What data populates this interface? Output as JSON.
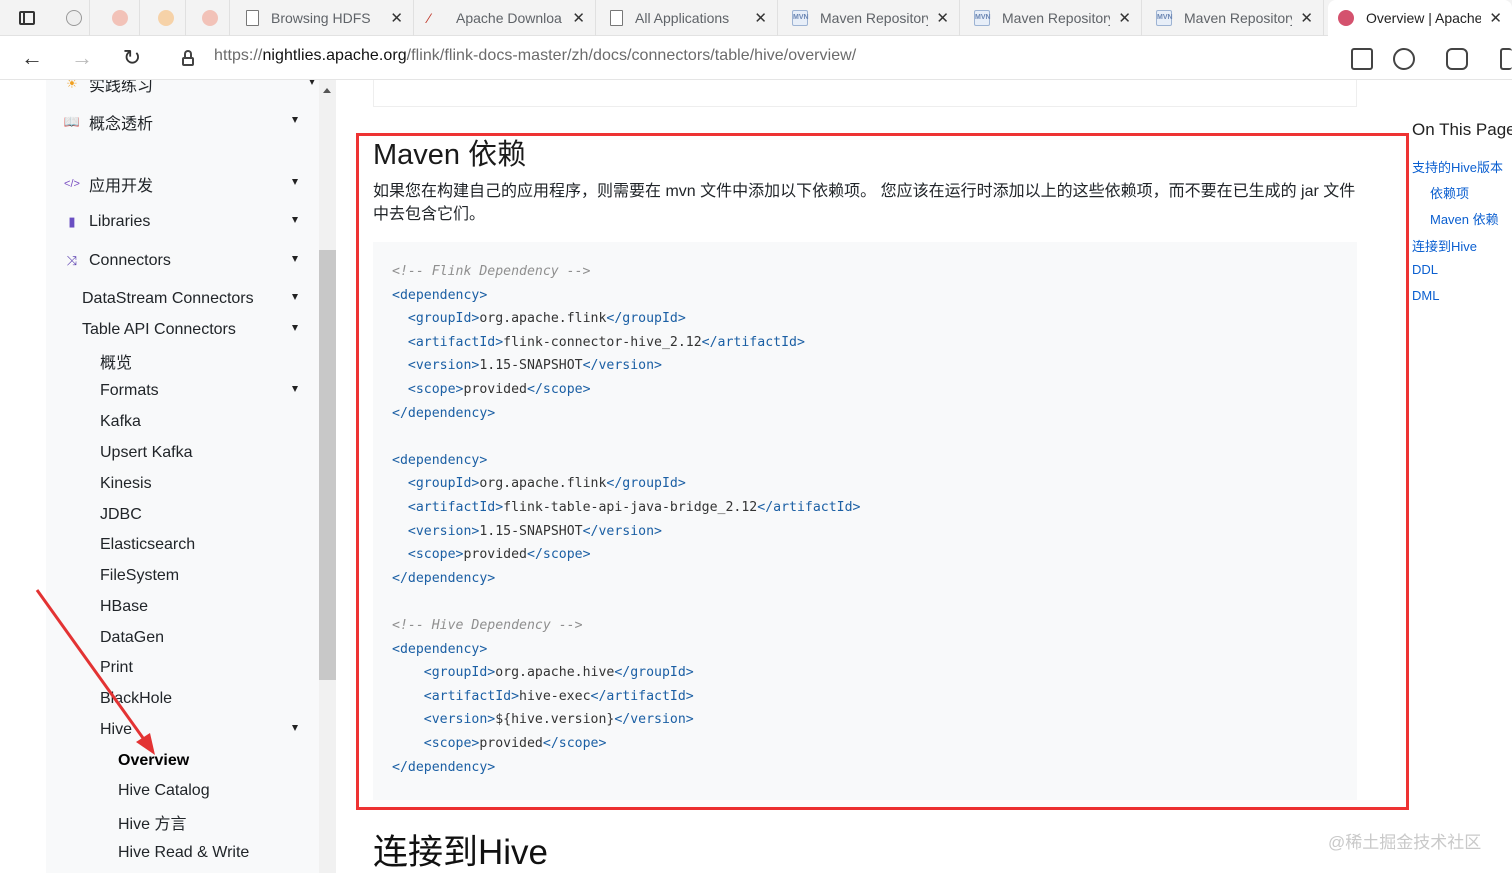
{
  "tabs": [
    {
      "label": "Browsing HDFS",
      "icon": "page-icon"
    },
    {
      "label": "Apache Downloa",
      "icon": "feather-icon"
    },
    {
      "label": "All Applications",
      "icon": "page-icon"
    },
    {
      "label": "Maven Repository",
      "icon": "mvn-icon"
    },
    {
      "label": "Maven Repository",
      "icon": "mvn-icon"
    },
    {
      "label": "Maven Repository",
      "icon": "mvn-icon"
    },
    {
      "label": "Overview | Apache",
      "icon": "flink-icon",
      "active": true
    }
  ],
  "address": {
    "prefix": "https://",
    "host": "nightlies.apache.org",
    "path": "/flink/flink-docs-master/zh/docs/connectors/table/hive/overview/"
  },
  "sidebar": {
    "top_partial": "实践练习",
    "items": [
      {
        "label": "概念透析",
        "icon": "book-icon",
        "caret": true
      },
      {
        "label": "应用开发",
        "icon": "code-icon",
        "caret": true
      },
      {
        "label": "Libraries",
        "icon": "library-icon",
        "caret": true
      },
      {
        "label": "Connectors",
        "icon": "shuffle-icon",
        "caret": true
      },
      {
        "label": "DataStream Connectors",
        "caret": true
      },
      {
        "label": "Table API Connectors",
        "caret": true
      },
      {
        "label": "概览"
      },
      {
        "label": "Formats",
        "caret": true
      },
      {
        "label": "Kafka"
      },
      {
        "label": "Upsert Kafka"
      },
      {
        "label": "Kinesis"
      },
      {
        "label": "JDBC"
      },
      {
        "label": "Elasticsearch"
      },
      {
        "label": "FileSystem"
      },
      {
        "label": "HBase"
      },
      {
        "label": "DataGen"
      },
      {
        "label": "Print"
      },
      {
        "label": "BlackHole"
      },
      {
        "label": "Hive",
        "caret": true
      },
      {
        "label": "Overview",
        "active": true
      },
      {
        "label": "Hive Catalog"
      },
      {
        "label": "Hive 方言"
      },
      {
        "label": "Hive Read & Write"
      }
    ]
  },
  "content": {
    "heading": "Maven 依赖",
    "paragraph": "如果您在构建自己的应用程序，则需要在 mvn 文件中添加以下依赖项。 您应该在运行时添加以上的这些依赖项，而不要在已生成的 jar 文件中去包含它们。",
    "code_lines": [
      {
        "kind": "comment",
        "indent": "",
        "text": "<!-- Flink Dependency -->"
      },
      {
        "kind": "open",
        "indent": "",
        "tag": "dependency"
      },
      {
        "kind": "elem",
        "indent": "  ",
        "tag": "groupId",
        "value": "org.apache.flink"
      },
      {
        "kind": "elem",
        "indent": "  ",
        "tag": "artifactId",
        "value": "flink-connector-hive_2.12"
      },
      {
        "kind": "elem",
        "indent": "  ",
        "tag": "version",
        "value": "1.15-SNAPSHOT"
      },
      {
        "kind": "elem",
        "indent": "  ",
        "tag": "scope",
        "value": "provided"
      },
      {
        "kind": "close",
        "indent": "",
        "tag": "dependency"
      },
      {
        "kind": "blank"
      },
      {
        "kind": "open",
        "indent": "",
        "tag": "dependency"
      },
      {
        "kind": "elem",
        "indent": "  ",
        "tag": "groupId",
        "value": "org.apache.flink"
      },
      {
        "kind": "elem",
        "indent": "  ",
        "tag": "artifactId",
        "value": "flink-table-api-java-bridge_2.12"
      },
      {
        "kind": "elem",
        "indent": "  ",
        "tag": "version",
        "value": "1.15-SNAPSHOT"
      },
      {
        "kind": "elem",
        "indent": "  ",
        "tag": "scope",
        "value": "provided"
      },
      {
        "kind": "close",
        "indent": "",
        "tag": "dependency"
      },
      {
        "kind": "blank"
      },
      {
        "kind": "comment",
        "indent": "",
        "text": "<!-- Hive Dependency -->"
      },
      {
        "kind": "open",
        "indent": "",
        "tag": "dependency"
      },
      {
        "kind": "elem",
        "indent": "    ",
        "tag": "groupId",
        "value": "org.apache.hive"
      },
      {
        "kind": "elem",
        "indent": "    ",
        "tag": "artifactId",
        "value": "hive-exec"
      },
      {
        "kind": "elem",
        "indent": "    ",
        "tag": "version",
        "value": "${hive.version}"
      },
      {
        "kind": "elem",
        "indent": "    ",
        "tag": "scope",
        "value": "provided"
      },
      {
        "kind": "close",
        "indent": "",
        "tag": "dependency"
      }
    ],
    "next_heading": "连接到Hive"
  },
  "toc": {
    "title": "On This Page",
    "items": [
      {
        "label": "支持的Hive版本",
        "level": 1
      },
      {
        "label": "依赖项",
        "level": 2
      },
      {
        "label": "Maven 依赖",
        "level": 2
      },
      {
        "label": "连接到Hive",
        "level": 1
      },
      {
        "label": "DDL",
        "level": 1
      },
      {
        "label": "DML",
        "level": 1
      }
    ]
  },
  "watermark": "@稀土掘金技术社区",
  "colors": {
    "annotation": "#e33333",
    "link": "#0b5fd0",
    "xml_tag": "#1b5fa4"
  }
}
